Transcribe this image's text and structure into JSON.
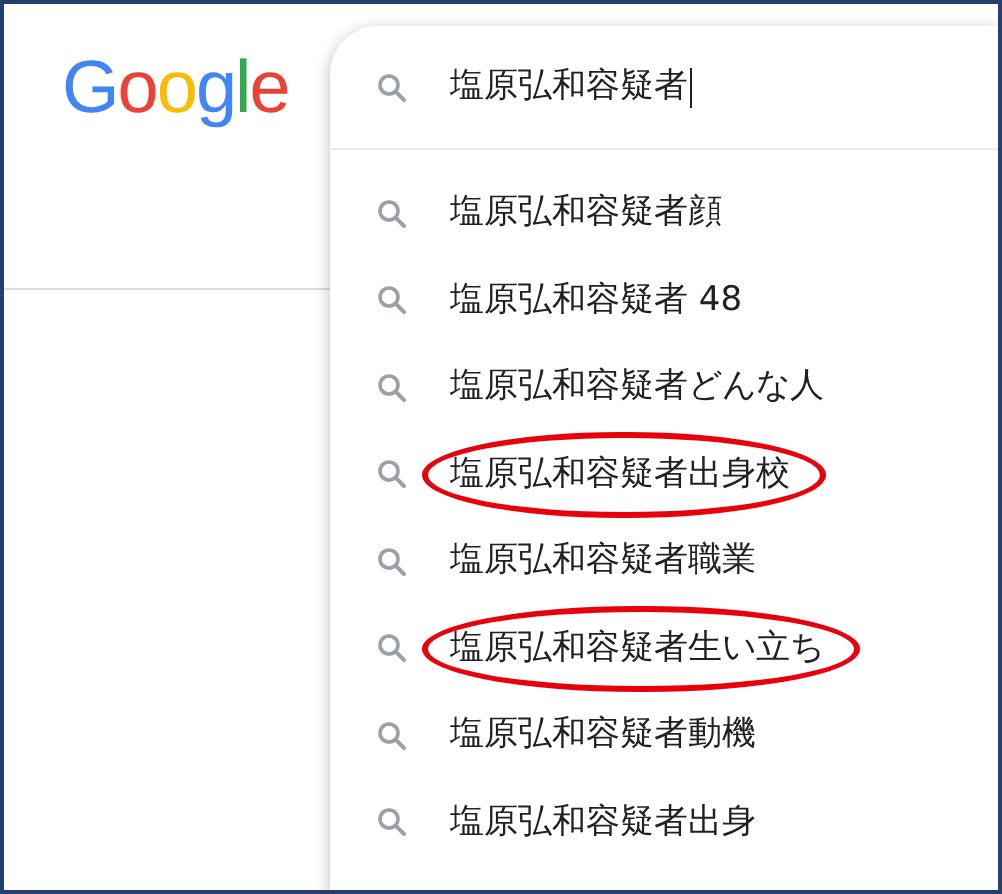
{
  "logo": "Google",
  "search": {
    "value": "塩原弘和容疑者"
  },
  "suggestions": [
    {
      "text": "塩原弘和容疑者顔",
      "circled": false
    },
    {
      "text": "塩原弘和容疑者 48",
      "circled": false
    },
    {
      "text": "塩原弘和容疑者どんな人",
      "circled": false
    },
    {
      "text": "塩原弘和容疑者出身校",
      "circled": true
    },
    {
      "text": "塩原弘和容疑者職業",
      "circled": false
    },
    {
      "text": "塩原弘和容疑者生い立ち",
      "circled": true
    },
    {
      "text": "塩原弘和容疑者動機",
      "circled": false
    },
    {
      "text": "塩原弘和容疑者出身",
      "circled": false
    }
  ]
}
